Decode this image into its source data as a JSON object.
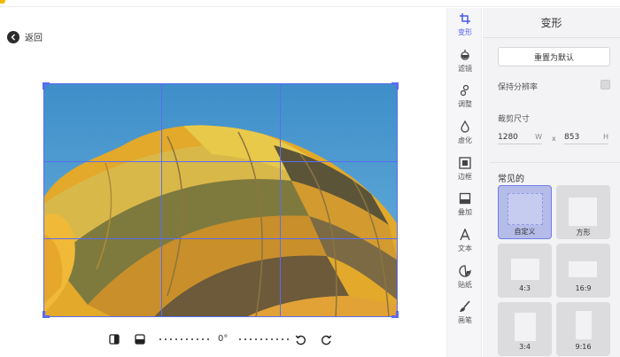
{
  "nav": {
    "back_label": "返回"
  },
  "editor": {
    "rotation_label": "0°"
  },
  "tools": [
    {
      "label": "变形",
      "icon": "crop-icon",
      "active": true
    },
    {
      "label": "滤镜",
      "icon": "filter-icon",
      "active": false
    },
    {
      "label": "调整",
      "icon": "adjust-icon",
      "active": false
    },
    {
      "label": "虚化",
      "icon": "blur-icon",
      "active": false
    },
    {
      "label": "边框",
      "icon": "frame-icon",
      "active": false
    },
    {
      "label": "叠加",
      "icon": "overlay-icon",
      "active": false
    },
    {
      "label": "文本",
      "icon": "text-icon",
      "active": false
    },
    {
      "label": "贴纸",
      "icon": "sticker-icon",
      "active": false
    },
    {
      "label": "画笔",
      "icon": "brush-icon",
      "active": false
    }
  ],
  "panel": {
    "title": "变形",
    "reset_label": "重置为默认",
    "keep_resolution_label": "保持分辨率",
    "crop_size_label": "裁剪尺寸",
    "width_value": "1280",
    "width_unit": "W",
    "times_symbol": "x",
    "height_value": "853",
    "height_unit": "H",
    "common_label": "常见的",
    "presets": [
      {
        "label": "自定义",
        "selected": true
      },
      {
        "label": "方形",
        "selected": false
      },
      {
        "label": "4:3",
        "selected": false
      },
      {
        "label": "16:9",
        "selected": false
      },
      {
        "label": "3:4",
        "selected": false
      },
      {
        "label": "9:16",
        "selected": false
      }
    ]
  },
  "colors": {
    "accent": "#4a5be8",
    "crop_grid": "#5a6cf0",
    "sky": "#4f9fd0"
  }
}
